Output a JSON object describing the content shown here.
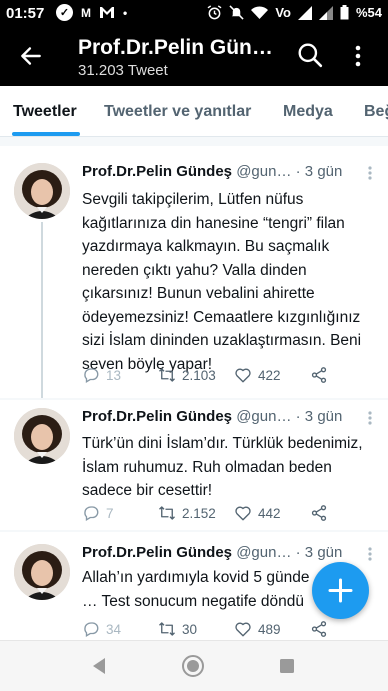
{
  "status_bar": {
    "time": "01:57",
    "left_badges": [
      "M"
    ],
    "battery": "%54",
    "network": "Vo"
  },
  "header": {
    "title": "Prof.Dr.Pelin Gün…",
    "subtitle": "31.203 Tweet"
  },
  "tabs": [
    {
      "label": "Tweetler",
      "active": true
    },
    {
      "label": "Tweetler ve yanıtlar",
      "active": false
    },
    {
      "label": "Medya",
      "active": false
    },
    {
      "label": "Beğ",
      "active": false
    }
  ],
  "tweets": [
    {
      "name": "Prof.Dr.Pelin Gündeş",
      "handle": "@gun…",
      "time": "· 3 gün",
      "text": "Sevgili takipçilerim, Lütfen nüfus kağıtlarınıza din hanesine “tengri” filan yazdırmaya kalkmayın. Bu saçmalık nereden çıktı yahu? Valla dinden çıkarsınız! Bunun vebalini ahirette ödeyemezsiniz! Cemaatlere kızgınlığınız sizi İslam dininden uzaklaştırmasın. Beni seven böyle yapar!",
      "replies": "13",
      "retweets": "2.103",
      "likes": "422"
    },
    {
      "name": "Prof.Dr.Pelin Gündeş",
      "handle": "@gun…",
      "time": "· 3 gün",
      "text": "Türk’ün dini İslam’dır. Türklük bedenimiz, İslam ruhumuz. Ruh olmadan beden sadece bir cesettir!",
      "replies": "7",
      "retweets": "2.152",
      "likes": "442"
    },
    {
      "name": "Prof.Dr.Pelin Gündeş",
      "handle": "@gun…",
      "time": "· 3 gün",
      "text": "Allah’ın yardımıyla kovid 5 günde … Test sonucum negatife döndü ç…",
      "replies": "34",
      "retweets": "30",
      "likes": "489"
    }
  ],
  "colors": {
    "accent": "#1d9bf0",
    "header_bg": "#000000",
    "muted_text": "#536471"
  }
}
